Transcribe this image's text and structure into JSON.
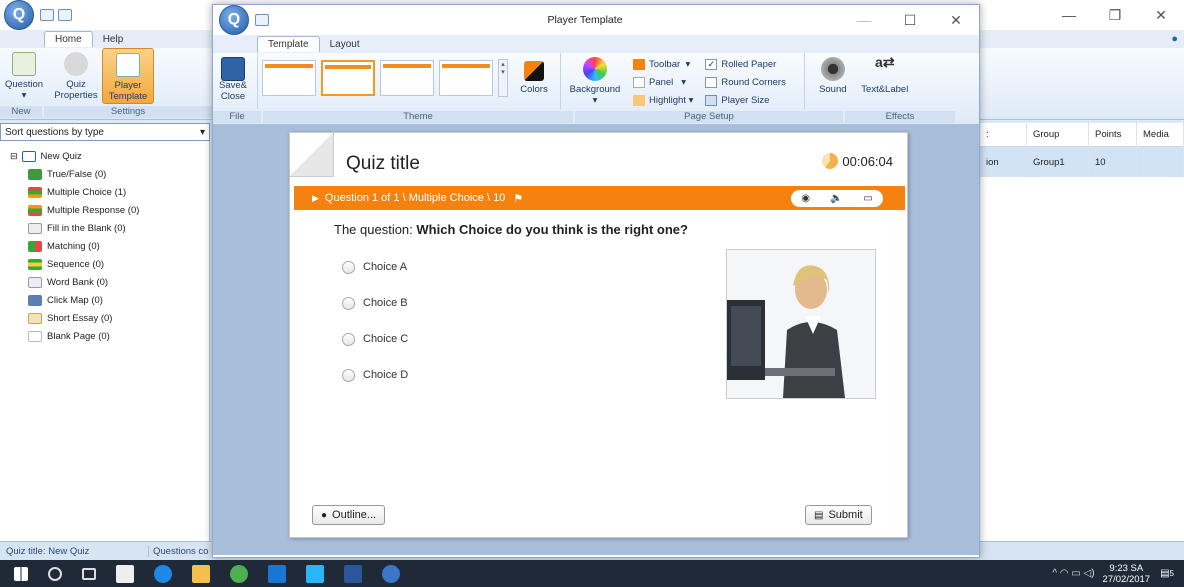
{
  "app": {
    "tabs": [
      "Home",
      "Help"
    ],
    "ribbon": {
      "buttons": [
        {
          "label": "Question",
          "sub": "▾"
        },
        {
          "label": "Quiz\nProperties"
        },
        {
          "label": "Player\nTemplate"
        }
      ],
      "groups": [
        "New",
        "Settings"
      ]
    },
    "sidebar": {
      "sort_label": "Sort questions by type",
      "root": "New Quiz",
      "items": [
        "True/False  (0)",
        "Multiple Choice  (1)",
        "Multiple Response  (0)",
        "Fill in the Blank  (0)",
        "Matching  (0)",
        "Sequence  (0)",
        "Word Bank  (0)",
        "Click Map  (0)",
        "Short Essay  (0)",
        "Blank Page  (0)"
      ]
    },
    "grid": {
      "headers": [
        "Group",
        "Points",
        "Media"
      ],
      "partial_header": ":",
      "row": {
        "partial": "ion",
        "group": "Group1",
        "points": "10"
      }
    },
    "status": {
      "quiz_title": "Quiz title: New Quiz",
      "questions": "Questions co"
    }
  },
  "player": {
    "title": "Player Template",
    "tabs": [
      "Template",
      "Layout"
    ],
    "ribbon": {
      "save_close": "Save&\nClose",
      "colors": "Colors",
      "background": "Background",
      "toolbar": "Toolbar",
      "panel": "Panel",
      "highlight": "Highlight",
      "rolled_paper": "Rolled Paper",
      "round_corners": "Round Corners",
      "player_size": "Player Size",
      "sound": "Sound",
      "text_label": "Text&Label",
      "groups": [
        "File",
        "Theme",
        "Page Setup",
        "Effects"
      ],
      "accent": "#f5820f"
    },
    "slide": {
      "title": "Quiz title",
      "timer": "00:06:04",
      "qbar": "Question 1 of 1 \\ Multiple Choice \\ 10",
      "question_prefix": "The question: ",
      "question_bold": "Which Choice do you think is the right one?",
      "choices": [
        "Choice A",
        "Choice B",
        "Choice C",
        "Choice D"
      ],
      "outline": "Outline...",
      "submit": "Submit"
    }
  },
  "taskbar": {
    "time": "9:23 SA",
    "date": "27/02/2017",
    "badge": "5"
  }
}
